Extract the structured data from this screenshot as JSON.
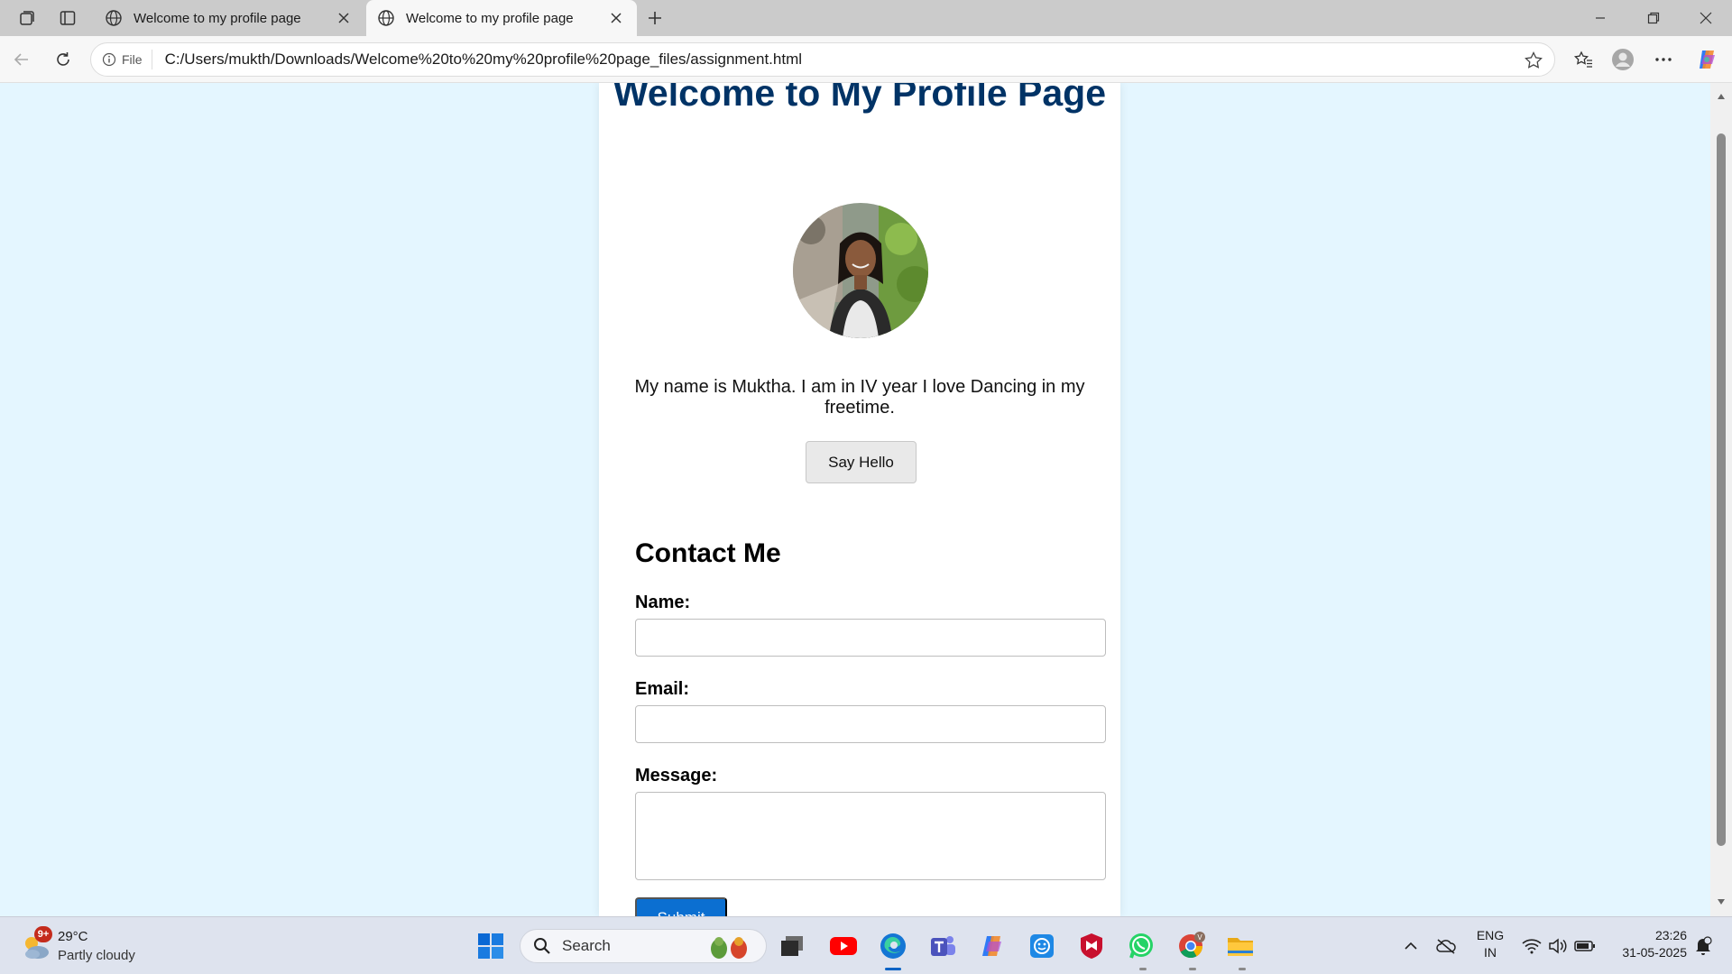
{
  "browser": {
    "tabs": [
      {
        "title": "Welcome to my profile page",
        "active": false
      },
      {
        "title": "Welcome to my profile page",
        "active": true
      }
    ],
    "address": {
      "scheme_label": "File",
      "url": "C:/Users/mukth/Downloads/Welcome%20to%20my%20profile%20page_files/assignment.html"
    }
  },
  "page": {
    "heading": "Welcome to My Profile Page",
    "bio": "My name is Muktha. I am in IV year I love Dancing in my freetime.",
    "hello_button": "Say Hello",
    "contact": {
      "heading": "Contact Me",
      "name_label": "Name:",
      "name_value": "",
      "email_label": "Email:",
      "email_value": "",
      "message_label": "Message:",
      "message_value": "",
      "submit_label": "Submit"
    }
  },
  "taskbar": {
    "weather": {
      "temp": "29°C",
      "desc": "Partly cloudy",
      "badge": "9+"
    },
    "search_label": "Search",
    "apps": [
      "task-view",
      "youtube",
      "edge",
      "teams",
      "copilot",
      "app-tile",
      "mcafee",
      "whatsapp",
      "chrome",
      "file-explorer"
    ],
    "language": {
      "line1": "ENG",
      "line2": "IN"
    },
    "clock": {
      "time": "23:26",
      "date": "31-05-2025"
    }
  },
  "colors": {
    "page_bg": "#e4f6ff",
    "heading": "#003366",
    "submit_bg": "#0b6fd1",
    "card_bg": "#ffffff"
  }
}
